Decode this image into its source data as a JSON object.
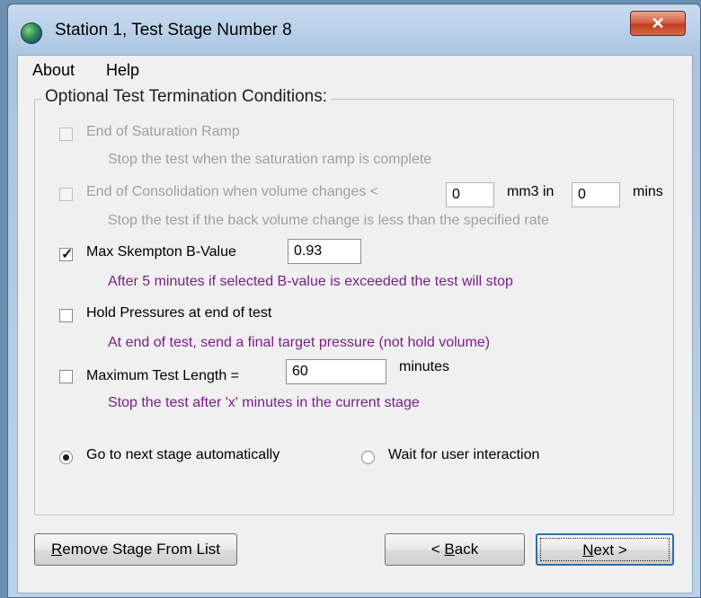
{
  "window": {
    "title": "Station 1, Test Stage Number 8",
    "close_glyph": "✕"
  },
  "menu": {
    "about": "About",
    "help": "Help"
  },
  "group": {
    "title": "Optional Test Termination Conditions:",
    "saturation": {
      "label": "End of Saturation Ramp",
      "checked": false,
      "enabled": false,
      "desc": "Stop the test when the saturation ramp is complete"
    },
    "consolidation": {
      "label": "End of Consolidation when volume changes <",
      "checked": false,
      "enabled": false,
      "volume_value": "0",
      "volume_unit": "mm3 in",
      "time_value": "0",
      "time_unit": "mins",
      "desc": "Stop the test if the back volume change is less than the specified rate"
    },
    "skempton": {
      "label": "Max Skempton B-Value",
      "checked": true,
      "enabled": true,
      "value": "0.93",
      "desc": "After 5 minutes if selected B-value is exceeded the test will stop"
    },
    "hold": {
      "label": "Hold Pressures at end of test",
      "checked": false,
      "enabled": true,
      "desc": "At end of test, send a final target pressure (not hold volume)"
    },
    "max_length": {
      "label": "Maximum Test Length =",
      "checked": false,
      "enabled": true,
      "value": "60",
      "unit": "minutes",
      "desc": "Stop the test after 'x' minutes in the current stage"
    },
    "radios": {
      "auto": {
        "label": "Go to next stage automatically",
        "selected": true
      },
      "wait": {
        "label": "Wait for user interaction",
        "selected": false
      }
    }
  },
  "buttons": {
    "remove": {
      "mnemonic": "R",
      "rest": "emove Stage From List"
    },
    "back": {
      "prefix": "< ",
      "mnemonic": "B",
      "rest": "ack"
    },
    "next": {
      "mnemonic": "N",
      "rest": "ext >"
    }
  },
  "colors": {
    "description_text": "#7a1f8a",
    "disabled_text": "#a0a0a0",
    "close_button": "#c2401f"
  }
}
